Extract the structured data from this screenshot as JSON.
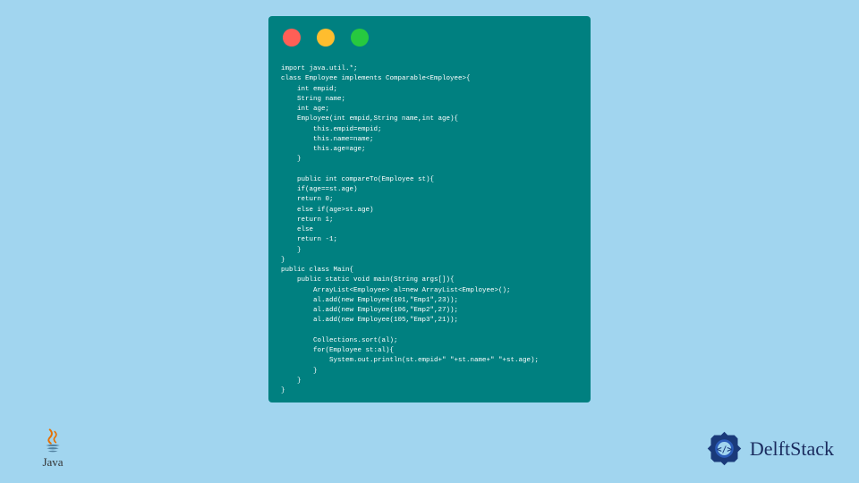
{
  "code": {
    "line01": "import java.util.*;",
    "line02": "class Employee implements Comparable<Employee>{",
    "line03": "    int empid;",
    "line04": "    String name;",
    "line05": "    int age;",
    "line06": "    Employee(int empid,String name,int age){",
    "line07": "        this.empid=empid;",
    "line08": "        this.name=name;",
    "line09": "        this.age=age;",
    "line10": "    }",
    "line11": "",
    "line12": "    public int compareTo(Employee st){",
    "line13": "    if(age==st.age)",
    "line14": "    return 0;",
    "line15": "    else if(age>st.age)",
    "line16": "    return 1;",
    "line17": "    else",
    "line18": "    return -1;",
    "line19": "    }",
    "line20": "}",
    "line21": "public class Main{",
    "line22": "    public static void main(String args[]){",
    "line23": "        ArrayList<Employee> al=new ArrayList<Employee>();",
    "line24": "        al.add(new Employee(101,\"Emp1\",23));",
    "line25": "        al.add(new Employee(106,\"Emp2\",27));",
    "line26": "        al.add(new Employee(105,\"Emp3\",21));",
    "line27": "",
    "line28": "        Collections.sort(al);",
    "line29": "        for(Employee st:al){",
    "line30": "            System.out.println(st.empid+\" \"+st.name+\" \"+st.age);",
    "line31": "        }",
    "line32": "    }",
    "line33": "}"
  },
  "logos": {
    "java": "Java",
    "delftstack": "DelftStack"
  }
}
